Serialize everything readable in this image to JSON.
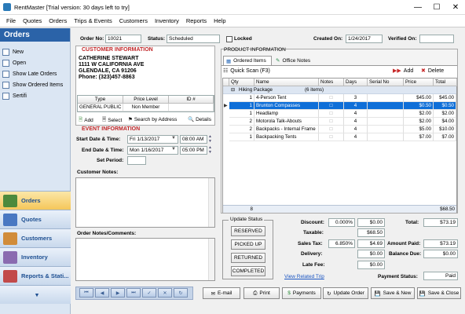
{
  "window": {
    "title": "RentMaster [Trial version: 30 days left to try]"
  },
  "menu": [
    "File",
    "Quotes",
    "Orders",
    "Trips & Events",
    "Customers",
    "Inventory",
    "Reports",
    "Help"
  ],
  "sidebar": {
    "header": "Orders",
    "links": [
      "New",
      "Open",
      "Show Late Orders",
      "Show Ordered Items",
      "Sertifi"
    ],
    "nav": [
      "Orders",
      "Quotes",
      "Customers",
      "Inventory",
      "Reports & Stati..."
    ]
  },
  "order": {
    "no_label": "Order No:",
    "no": "10021",
    "status_label": "Status:",
    "status": "Scheduled",
    "locked_label": "Locked",
    "created_label": "Created On:",
    "created": "1/24/2017",
    "verified_label": "Verified On:",
    "verified": ""
  },
  "customer": {
    "section": "CUSTOMER INFORMATION",
    "name": "CATHERINE STEWART",
    "addr1": "1111 W CALIFORNIA AVE",
    "addr2": "GLENDALE, CA 91206",
    "phone": "Phone: (323)457-8863",
    "cols": [
      "Type",
      "Price Level",
      "ID #"
    ],
    "row": [
      "GENERAL PUBLIC",
      "Non Member",
      ""
    ],
    "add": "Add",
    "select": "Select",
    "search": "Search by Address",
    "details": "Details"
  },
  "event": {
    "section": "EVENT INFORMATION",
    "start_label": "Start Date & Time:",
    "start_date": "Fri 1/13/2017",
    "start_time": "08:00 AM",
    "end_label": "End Date & Time:",
    "end_date": "Mon 1/16/2017",
    "end_time": "05:00 PM",
    "period_label": "Set Period:",
    "period": ""
  },
  "notes": {
    "customer_label": "Customer Notes:",
    "order_label": "Order Notes/Comments:"
  },
  "product": {
    "section": "PRODUCT INFORMATION",
    "tabs": [
      "Ordered Items",
      "Office Notes"
    ],
    "quick_scan": "Quick Scan (F3)",
    "add": "Add",
    "delete": "Delete",
    "cols": [
      "Qty",
      "Name",
      "Notes",
      "Days",
      "Serial No",
      "Price",
      "Total"
    ],
    "group": "Hiking Package",
    "group_count": "(6 items)",
    "rows": [
      {
        "qty": "1",
        "name": "4-Person Tent",
        "days": "3",
        "price": "$45.00",
        "total": "$45.00"
      },
      {
        "qty": "1",
        "name": "Brunton Compasses",
        "days": "4",
        "price": "$0.50",
        "total": "$0.50"
      },
      {
        "qty": "1",
        "name": "Headlamp",
        "days": "4",
        "price": "$2.00",
        "total": "$2.00"
      },
      {
        "qty": "2",
        "name": "Motorola Talk-Abouts",
        "days": "4",
        "price": "$2.00",
        "total": "$4.00"
      },
      {
        "qty": "2",
        "name": "Backpacks - Internal Frame",
        "days": "4",
        "price": "$5.00",
        "total": "$10.00"
      },
      {
        "qty": "1",
        "name": "Backpacking Tents",
        "days": "4",
        "price": "$7.00",
        "total": "$7.00"
      }
    ],
    "footer_qty": "8",
    "footer_total": "$68.50"
  },
  "update_status": {
    "title": "Update Status",
    "buttons": [
      "RESERVED",
      "PICKED UP",
      "RETURNED",
      "COMPLETED"
    ]
  },
  "totals": {
    "discount_label": "Discount:",
    "discount_pct": "0.000%",
    "discount_amt": "$0.00",
    "total_label": "Total:",
    "total": "$73.19",
    "taxable_label": "Taxable:",
    "taxable": "$68.50",
    "tax_label": "Sales Tax:",
    "tax_pct": "6.850%",
    "tax_amt": "$4.69",
    "paid_label": "Amount Paid:",
    "paid": "$73.19",
    "delivery_label": "Delivery:",
    "delivery": "$0.00",
    "due_label": "Balance Due:",
    "due": "$0.00",
    "late_label": "Late Fee:",
    "late": "$0.00",
    "trip_link": "View Related Trip",
    "pstatus_label": "Payment Status:",
    "pstatus": "Paid"
  },
  "actions": [
    "E-mail",
    "Print",
    "Payments",
    "Update Order",
    "Save & New",
    "Save & Close"
  ]
}
